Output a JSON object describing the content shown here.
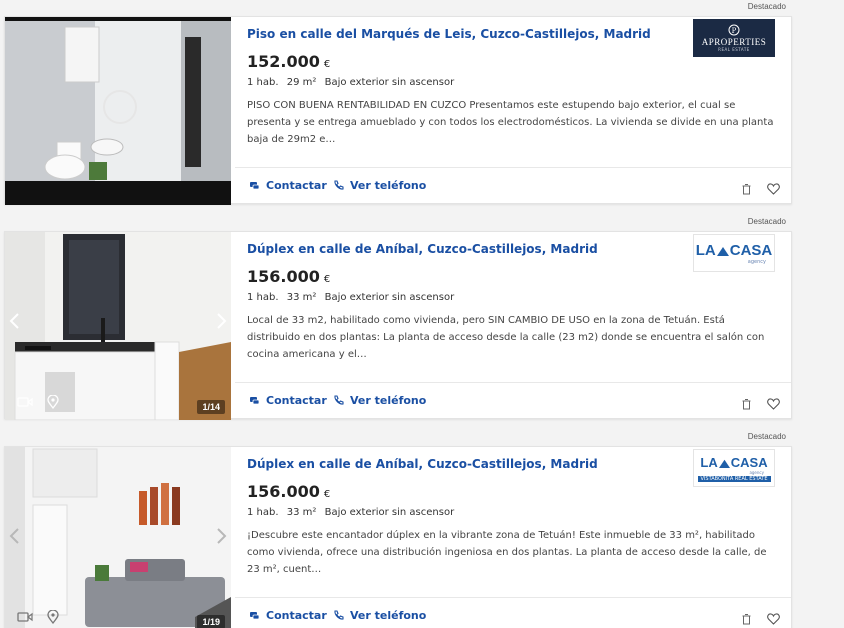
{
  "listings": [
    {
      "badge": "Destacado",
      "title": "Piso en calle del Marqués de Leis, Cuzco-Castillejos, Madrid",
      "price": "152.000",
      "currency": "€",
      "rooms": "1 hab.",
      "area": "29 m²",
      "floor": "Bajo exterior sin ascensor",
      "description": "PISO CON BUENA RENTABILIDAD EN CUZCO Presentamos este estupendo bajo exterior, el cual se presenta y se entrega amueblado y con todos los electrodomésticos. La vivienda se divide en una planta baja de 29m2 e…",
      "contact_label": "Contactar",
      "phone_label": "Ver teléfono",
      "agency": {
        "name": "APROPERTIES",
        "subtitle": "REAL ESTATE",
        "logo_bg": "#1b2a44"
      }
    },
    {
      "badge": "Destacado",
      "title": "Dúplex en calle de Aníbal, Cuzco-Castillejos, Madrid",
      "price": "156.000",
      "currency": "€",
      "rooms": "1 hab.",
      "area": "33 m²",
      "floor": "Bajo exterior sin ascensor",
      "description": "Local de 33 m2, habilitado como vivienda, pero SIN CAMBIO DE USO en la zona de Tetuán. Está distribuido en dos plantas: La planta de acceso desde la calle (23 m2) donde se encuentra el salón con cocina americana y el…",
      "contact_label": "Contactar",
      "phone_label": "Ver teléfono",
      "photo_counter": "1/14",
      "agency": {
        "name_a": "LA",
        "name_b": "CASA",
        "subtitle": "agency",
        "color": "#1f5fa8"
      }
    },
    {
      "badge": "Destacado",
      "title": "Dúplex en calle de Aníbal, Cuzco-Castillejos, Madrid",
      "price": "156.000",
      "currency": "€",
      "rooms": "1 hab.",
      "area": "33 m²",
      "floor": "Bajo exterior sin ascensor",
      "description": "¡Descubre este encantador dúplex en la vibrante zona de Tetuán! Este inmueble de 33 m², habilitado como vivienda, ofrece una distribución ingeniosa en dos plantas. La planta de acceso desde la calle, de 23 m², cuent…",
      "contact_label": "Contactar",
      "phone_label": "Ver teléfono",
      "photo_counter": "1/19",
      "agency": {
        "name_a": "LA",
        "name_b": "CASA",
        "subtitle": "agency",
        "tagline": "VISTABONITA REAL ESTATE",
        "color": "#1f5fa8"
      }
    }
  ],
  "colors": {
    "link": "#1a4fa3",
    "text": "#333333",
    "background": "#f3f3f3"
  }
}
